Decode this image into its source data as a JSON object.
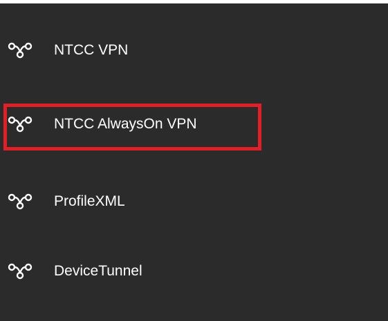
{
  "vpn_list": {
    "items": [
      {
        "label": "NTCC VPN",
        "icon": "vpn-connection-icon"
      },
      {
        "label": "NTCC AlwaysOn VPN",
        "icon": "vpn-connection-icon",
        "highlighted": true
      },
      {
        "label": "ProfileXML",
        "icon": "vpn-connection-icon"
      },
      {
        "label": "DeviceTunnel",
        "icon": "vpn-connection-icon"
      }
    ]
  },
  "colors": {
    "panel_background": "#2b2b2b",
    "text": "#ffffff",
    "highlight_border": "#e41e26"
  }
}
